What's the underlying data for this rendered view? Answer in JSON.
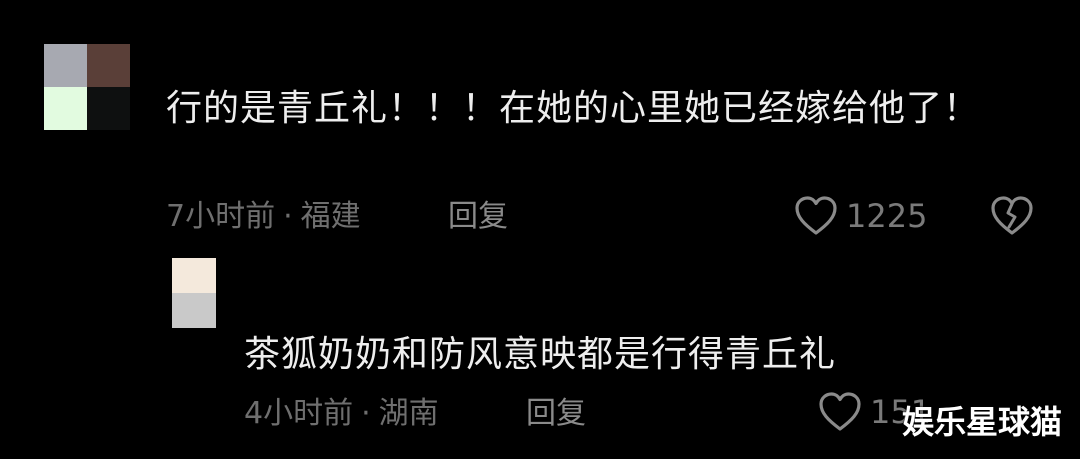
{
  "comment": {
    "text": "行的是青丘礼！！！在她的心里她已经嫁给他了！",
    "time": "7小时前",
    "separator": "·",
    "location": "福建",
    "reply_label": "回复",
    "like_count": "1225"
  },
  "reply": {
    "text": "茶狐奶奶和防风意映都是行得青丘礼",
    "time": "4小时前",
    "separator": "·",
    "location": "湖南",
    "reply_label": "回复",
    "like_count": "151"
  },
  "watermark": "娱乐星球猫",
  "icons": {
    "like": "heart-outline-icon",
    "dislike": "broken-heart-icon"
  },
  "colors": {
    "background": "#000000",
    "text": "#eeeeee",
    "meta": "#6f6f6f",
    "icon": "#8a8a8a"
  }
}
